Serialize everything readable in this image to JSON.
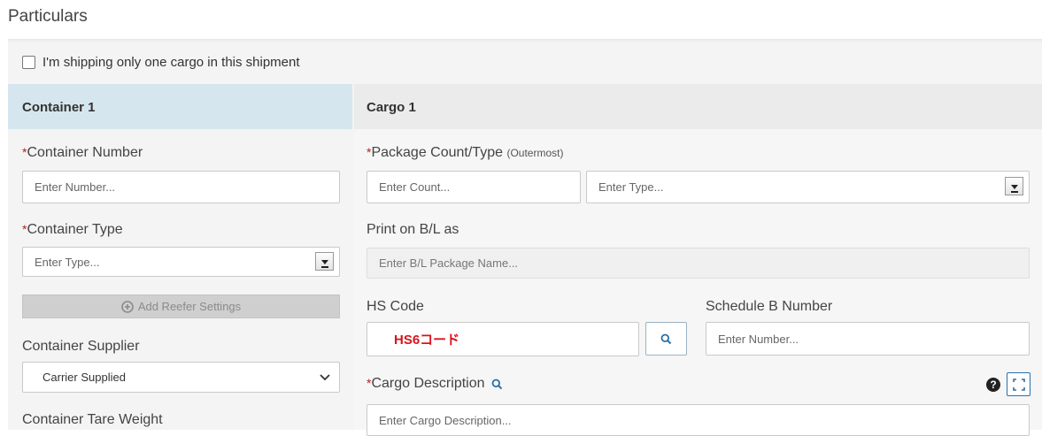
{
  "section_title": "Particulars",
  "single_cargo": {
    "label": "I'm shipping only one cargo in this shipment",
    "checked": false
  },
  "container": {
    "header": "Container 1",
    "number": {
      "label": "Container Number",
      "placeholder": "Enter Number..."
    },
    "type": {
      "label": "Container Type",
      "placeholder": "Enter Type..."
    },
    "reefer_button": "Add Reefer Settings",
    "supplier": {
      "label": "Container Supplier",
      "value": "Carrier Supplied"
    },
    "tare_weight": {
      "label": "Container Tare Weight"
    }
  },
  "cargo": {
    "header": "Cargo 1",
    "package": {
      "label": "Package Count/Type",
      "note": "(Outermost)",
      "count_placeholder": "Enter Count...",
      "type_placeholder": "Enter Type..."
    },
    "print_bl": {
      "label": "Print on B/L as",
      "placeholder": "Enter B/L Package Name..."
    },
    "hs_code": {
      "label": "HS Code",
      "value": "HS6コード"
    },
    "schedule_b": {
      "label": "Schedule B Number",
      "placeholder": "Enter Number..."
    },
    "description": {
      "label": "Cargo Description",
      "placeholder": "Enter Cargo Description..."
    }
  },
  "required_marker": "*",
  "colors": {
    "required": "#b21e23",
    "hs_value": "#d8141b",
    "left_header": "#d6e6ee",
    "right_header": "#ebebeb",
    "icon_blue": "#2a6fa8"
  },
  "icons": [
    "plus-circle-icon",
    "search-icon",
    "help-icon",
    "expand-icon",
    "dropdown-arrow-icon",
    "chevron-down-icon"
  ]
}
